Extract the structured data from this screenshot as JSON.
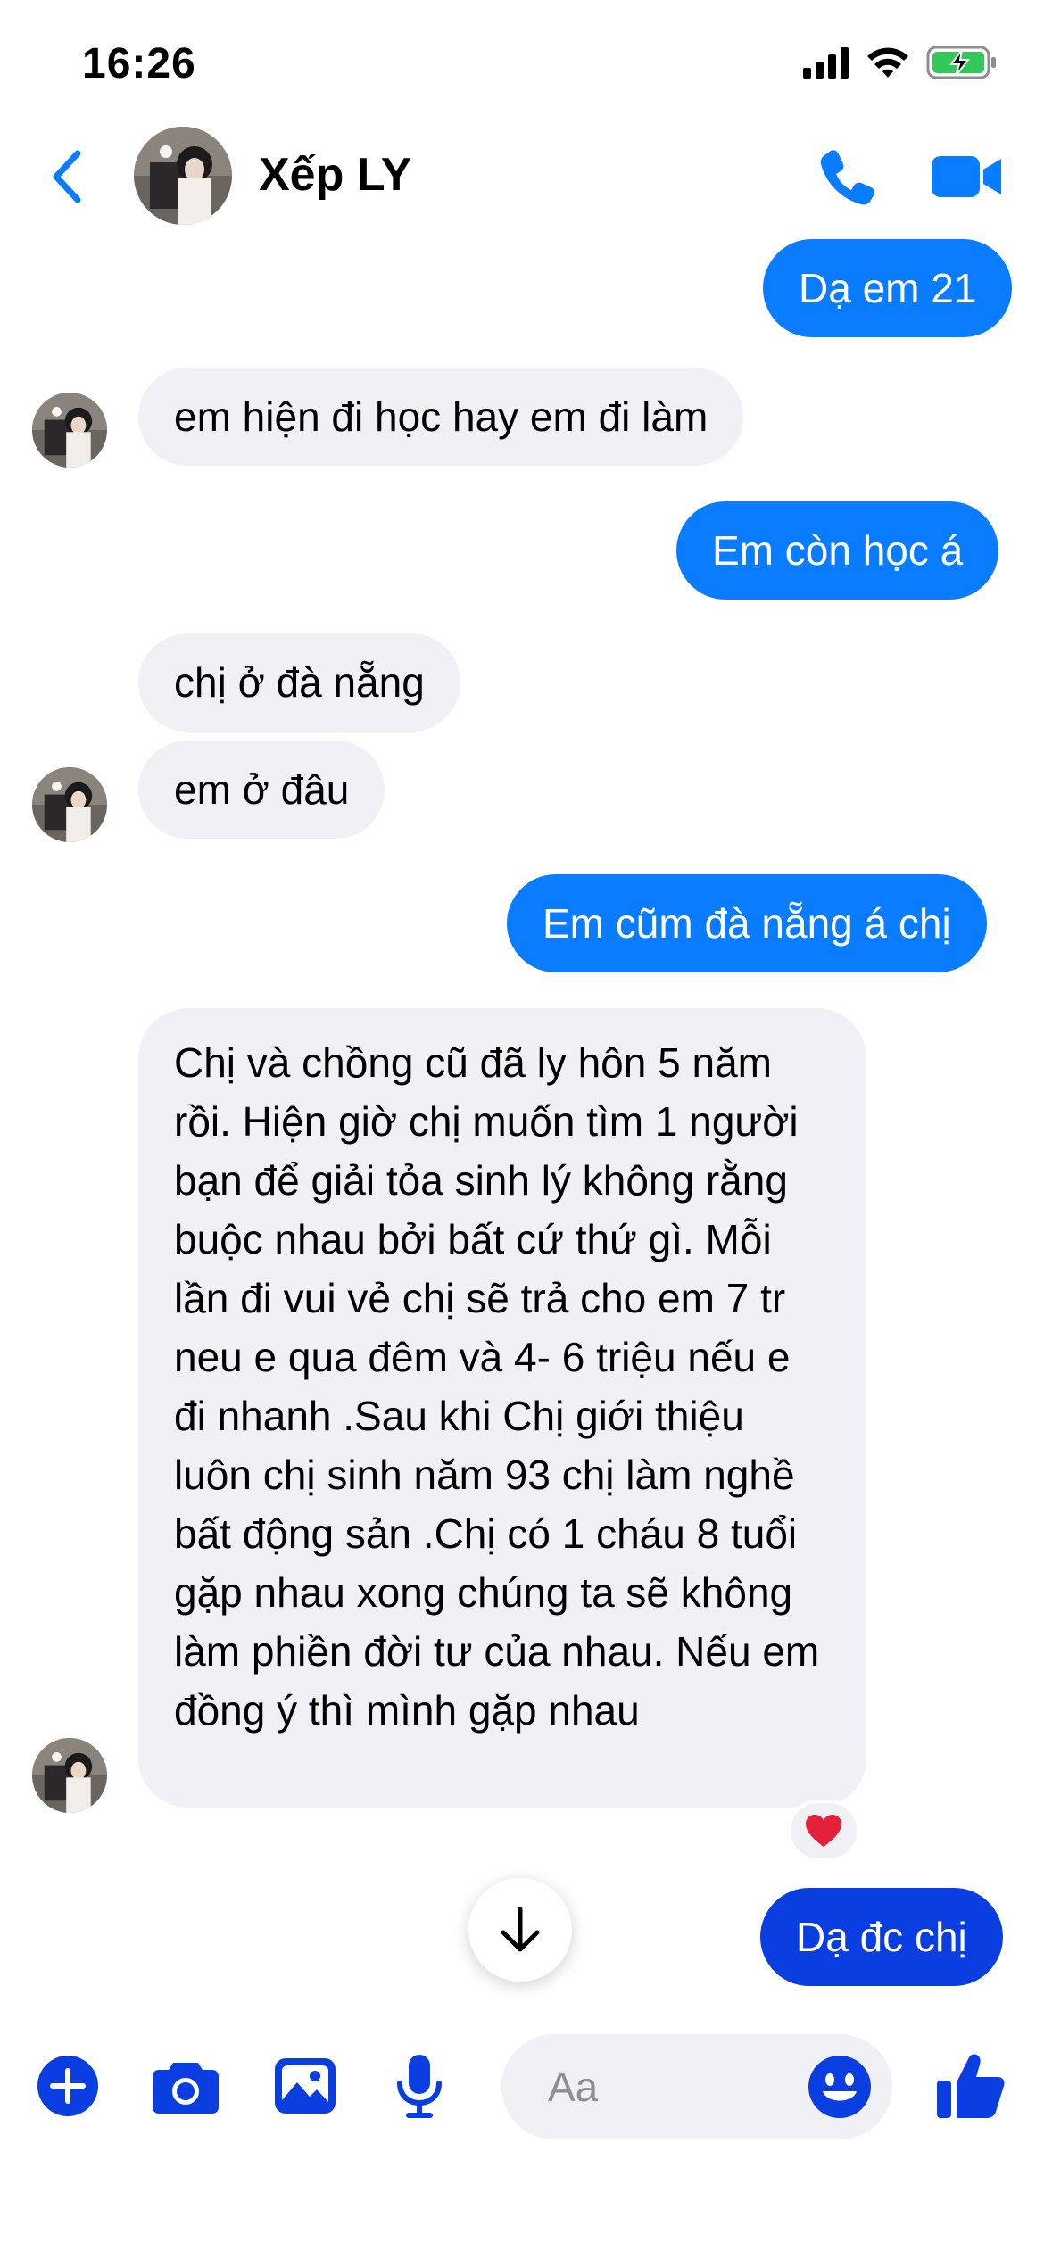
{
  "status_bar": {
    "time": "16:26"
  },
  "header": {
    "contact_name": "Xếp LY"
  },
  "messages": [
    {
      "from": "me",
      "text": "Dạ em 21"
    },
    {
      "from": "them",
      "text": "em hiện đi học hay em đi làm"
    },
    {
      "from": "me",
      "text": "Em còn học á"
    },
    {
      "from": "them",
      "text": "chị ở đà nẵng"
    },
    {
      "from": "them",
      "text": "em ở đâu"
    },
    {
      "from": "me",
      "text": "Em cũm đà nẵng á chị"
    },
    {
      "from": "them",
      "text": "Chị và chồng cũ đã ly hôn 5 năm rồi. Hiện giờ chị muốn tìm 1 người bạn để giải tỏa sinh lý không rằng buộc nhau bởi bất cứ thứ gì. Mỗi lần đi vui vẻ chị sẽ trả cho em 7 tr neu e qua đêm và 4- 6 triệu nếu e đi nhanh .Sau khi Chị giới thiệu luôn chị sinh năm 93 chị làm nghề bất động sản .Chị có 1 cháu 8 tuổi gặp nhau xong chúng ta sẽ không làm phiền đời tư của nhau. Nếu em đồng ý thì mình gặp nhau"
    },
    {
      "from": "me",
      "text": "Dạ đc chị"
    }
  ],
  "reaction": {
    "emoji": "❤️",
    "icon": "heart-icon"
  },
  "composer": {
    "placeholder": "Aa"
  },
  "colors": {
    "outgoing_bubble": "#0a7cff",
    "outgoing_bubble_latest": "#0b3ee0",
    "incoming_bubble": "#f0f0f5",
    "accent_icon": "#0a7cff"
  }
}
